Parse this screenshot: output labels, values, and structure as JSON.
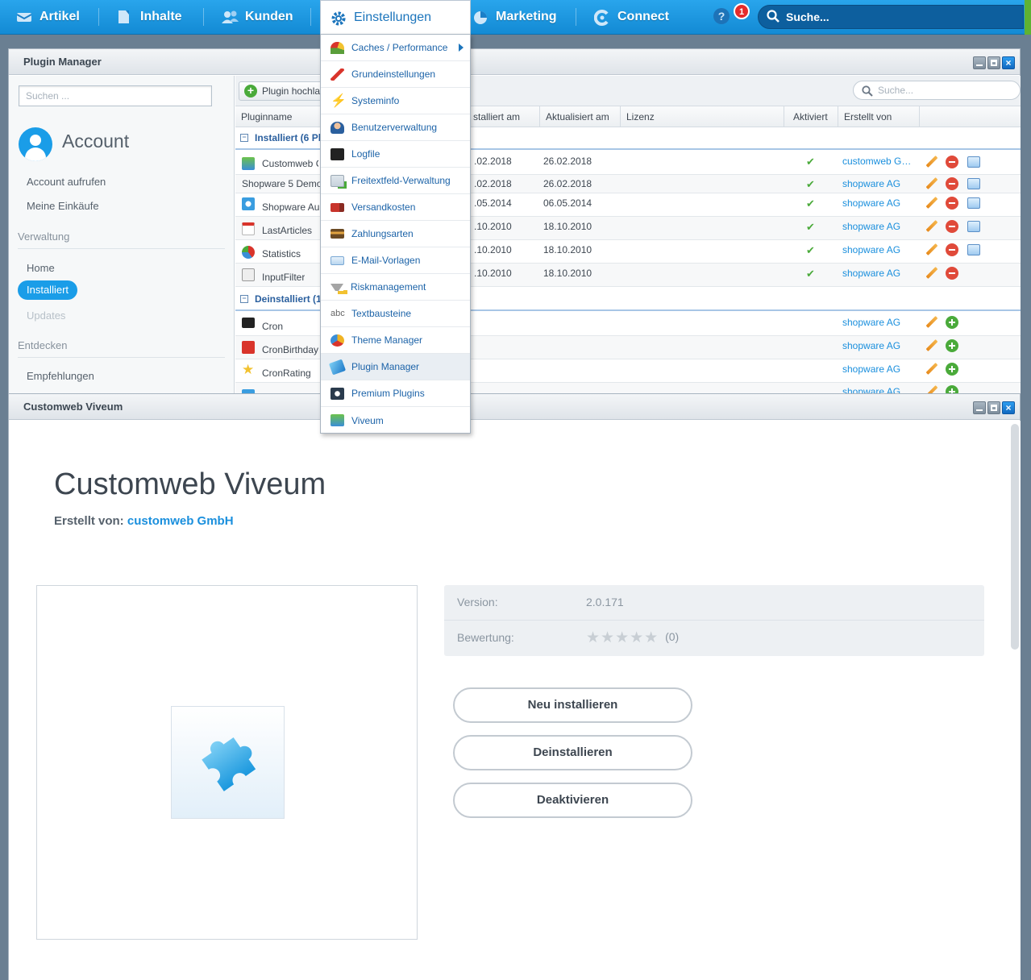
{
  "nav": {
    "items": [
      {
        "label": "Artikel"
      },
      {
        "label": "Inhalte"
      },
      {
        "label": "Kunden"
      },
      {
        "label": "Einstellungen"
      },
      {
        "label": "Marketing"
      },
      {
        "label": "Connect"
      }
    ],
    "help": "?",
    "notifications": "1",
    "search_placeholder": "Suche..."
  },
  "plugin_manager": {
    "title": "Plugin Manager",
    "sidebar": {
      "search_placeholder": "Suchen ...",
      "account_title": "Account",
      "links": [
        "Account aufrufen",
        "Meine Einkäufe"
      ],
      "section_admin": "Verwaltung",
      "home": "Home",
      "installed": "Installiert",
      "updates": "Updates",
      "section_discover": "Entdecken",
      "recommendations": "Empfehlungen"
    },
    "toolbar": {
      "upload": "Plugin hochla",
      "search_placeholder": "Suche..."
    },
    "columns": {
      "name": "Pluginname",
      "installed_at": "stalliert am",
      "updated_at": "Aktualisiert am",
      "license": "Lizenz",
      "active": "Aktiviert",
      "author": "Erstellt von"
    },
    "group_installed": "Installiert (6 Pl",
    "group_uninstalled": "Deinstalliert (1",
    "installed_rows": [
      {
        "name": "Customweb C",
        "installed": ".02.2018",
        "updated": "26.02.2018",
        "active": "✔",
        "author": "customweb G…"
      },
      {
        "name": "Shopware 5 Demo",
        "installed": ".02.2018",
        "updated": "26.02.2018",
        "active": "✔",
        "author": "shopware AG"
      },
      {
        "name": "Shopware Au",
        "installed": ".05.2014",
        "updated": "06.05.2014",
        "active": "✔",
        "author": "shopware AG"
      },
      {
        "name": "LastArticles",
        "installed": ".10.2010",
        "updated": "18.10.2010",
        "active": "✔",
        "author": "shopware AG"
      },
      {
        "name": "Statistics",
        "installed": ".10.2010",
        "updated": "18.10.2010",
        "active": "✔",
        "author": "shopware AG"
      },
      {
        "name": "InputFilter",
        "installed": ".10.2010",
        "updated": "18.10.2010",
        "active": "✔",
        "author": "shopware AG"
      }
    ],
    "uninstalled_rows": [
      {
        "name": "Cron",
        "author": "shopware AG"
      },
      {
        "name": "CronBirthday",
        "author": "shopware AG"
      },
      {
        "name": "CronRating",
        "author": "shopware AG"
      },
      {
        "name": "",
        "author": "shopware AG"
      }
    ]
  },
  "viveum": {
    "window_title": "Customweb Viveum",
    "title": "Customweb Viveum",
    "author_label": "Erstellt von:",
    "author": "customweb GmbH",
    "version_label": "Version:",
    "version": "2.0.171",
    "rating_label": "Bewertung:",
    "rating_stars": "★★★★★",
    "rating_count": "(0)",
    "rating_value": 0,
    "buttons": {
      "reinstall": "Neu installieren",
      "uninstall": "Deinstallieren",
      "deactivate": "Deaktivieren"
    }
  },
  "menu": {
    "items": [
      {
        "label": "Caches / Performance",
        "icon": "speedometer-icon",
        "color": "#5a9e3a"
      },
      {
        "label": "Grundeinstellungen",
        "icon": "wrench-icon",
        "color": "#d9342b"
      },
      {
        "label": "Systeminfo",
        "icon": "lightning-icon",
        "color": "#ef6b1f"
      },
      {
        "label": "Benutzerverwaltung",
        "icon": "user-icon",
        "color": "#c7834f"
      },
      {
        "label": "Logfile",
        "icon": "terminal-icon",
        "color": "#2b2b2b"
      },
      {
        "label": "Freitextfeld-Verwaltung",
        "icon": "form-add-icon",
        "color": "#7fb56b"
      },
      {
        "label": "Versandkosten",
        "icon": "truck-icon",
        "color": "#c8342b"
      },
      {
        "label": "Zahlungsarten",
        "icon": "credit-card-icon",
        "color": "#7b5a2e"
      },
      {
        "label": "E-Mail-Vorlagen",
        "icon": "mail-template-icon",
        "color": "#5b9fd6"
      },
      {
        "label": "Riskmanagement",
        "icon": "filter-warning-icon",
        "color": "#9a9a9a"
      },
      {
        "label": "Textbausteine",
        "icon": "abc-icon",
        "color": "#666666"
      },
      {
        "label": "Theme Manager",
        "icon": "palette-icon",
        "color": "#f0b323"
      },
      {
        "label": "Plugin Manager",
        "icon": "puzzle-icon",
        "color": "#3a8ed8"
      },
      {
        "label": "Premium Plugins",
        "icon": "premium-c-icon",
        "color": "#2a3b4d"
      },
      {
        "label": "Viveum",
        "icon": "plugin-window-icon",
        "color": "#4aaa3a"
      }
    ]
  },
  "colors": {
    "accent": "#1a9de8",
    "link": "#1a8fdd",
    "topbar": "#138ad4"
  }
}
